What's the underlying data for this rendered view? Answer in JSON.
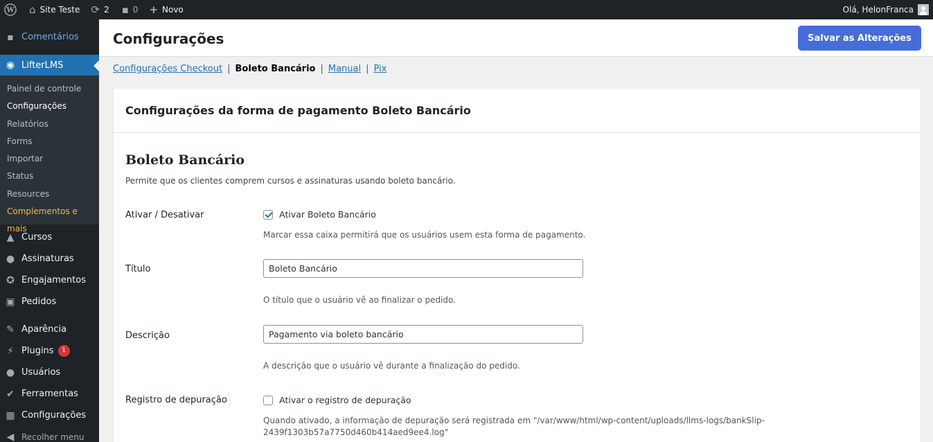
{
  "adminbar": {
    "site_name": "Site Teste",
    "updates_count": "2",
    "comments_count": "0",
    "new_label": "Novo",
    "greeting": "Olá, HelonFranca"
  },
  "sidebar": {
    "top_items": [
      {
        "label": "Comentários",
        "icon": "comment-icon"
      },
      {
        "label": "LifterLMS",
        "icon": "lifterlms-icon"
      }
    ],
    "submenu": [
      "Painel de controle",
      "Configurações",
      "Relatórios",
      "Forms",
      "Importar",
      "Status",
      "Resources",
      "Complementos e mais"
    ],
    "items": [
      {
        "label": "Cursos",
        "icon": "graduation-cap-icon"
      },
      {
        "label": "Assinaturas",
        "icon": "groups-icon"
      },
      {
        "label": "Engajamentos",
        "icon": "award-icon"
      },
      {
        "label": "Pedidos",
        "icon": "cart-icon"
      },
      {
        "label": "Aparência",
        "icon": "paint-brush-icon"
      },
      {
        "label": "Plugins",
        "icon": "plugin-icon",
        "badge": "1"
      },
      {
        "label": "Usuários",
        "icon": "users-icon"
      },
      {
        "label": "Ferramentas",
        "icon": "wrench-icon"
      },
      {
        "label": "Configurações",
        "icon": "settings-icon"
      },
      {
        "label": "Recolher menu",
        "icon": "collapse-icon"
      }
    ]
  },
  "header": {
    "title": "Configurações",
    "save_label": "Salvar as Alterações"
  },
  "subtabs": {
    "checkout": "Configurações Checkout",
    "current": "Boleto Bancário",
    "manual": "Manual",
    "pix": "Pix",
    "separator": "|"
  },
  "panel": {
    "title": "Configurações da forma de pagamento Boleto Bancário",
    "section_title": "Boleto Bancário",
    "section_desc": "Permite que os clientes comprem cursos e assinaturas usando boleto bancário.",
    "enable": {
      "label": "Ativar / Desativar",
      "checkbox_label": "Ativar Boleto Bancário",
      "checked": true,
      "help": "Marcar essa caixa permitirá que os usuários usem esta forma de pagamento."
    },
    "title_field": {
      "label": "Título",
      "value": "Boleto Bancário",
      "help": "O título que o usuário vê ao finalizar o pedido."
    },
    "description_field": {
      "label": "Descrição",
      "value": "Pagamento via boleto bancário",
      "help": "A descrição que o usuário vê durante a finalização do pedido."
    },
    "debug": {
      "label": "Registro de depuração",
      "checkbox_label": "Ativar o registro de depuração",
      "checked": false,
      "help_line1": "Quando ativado, a informação de depuração será registrada em \"/var/www/html/wp-content/uploads/llms-logs/bankSlip-",
      "help_line2": "2439f1303b57a7750d460b414aed9ee4.log\""
    }
  }
}
